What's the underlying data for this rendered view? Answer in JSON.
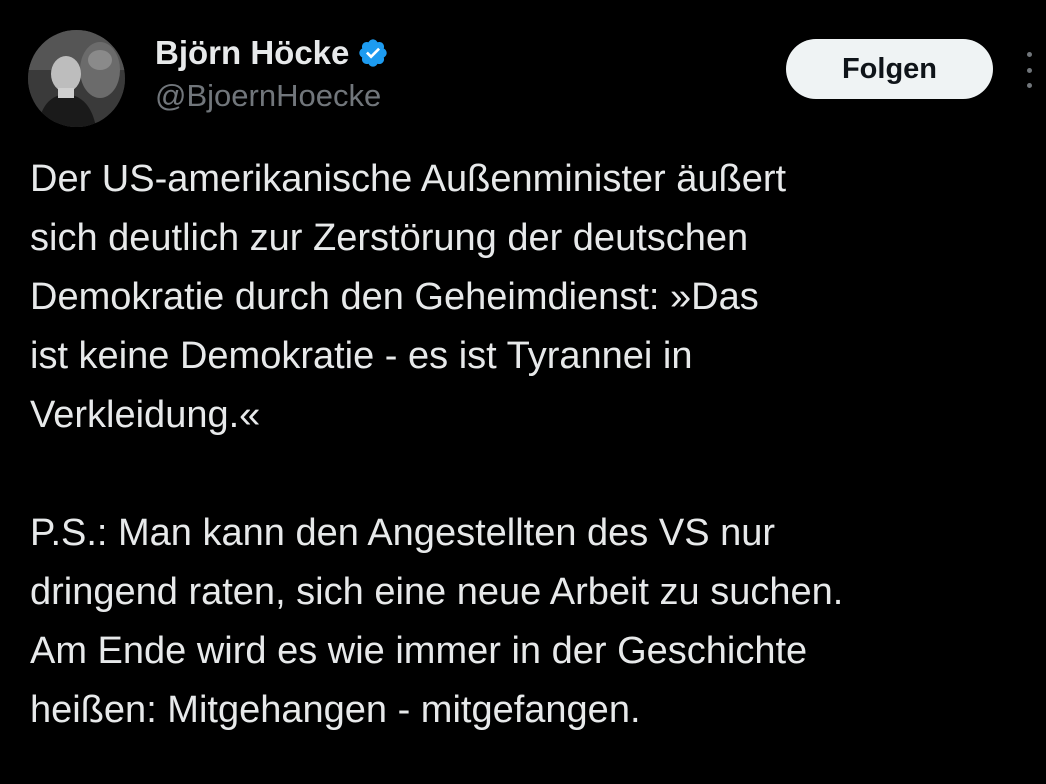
{
  "author": {
    "display_name": "Björn Höcke",
    "handle": "@BjoernHoecke",
    "verified": true,
    "avatar_icon": "profile-photo-icon"
  },
  "actions": {
    "follow_label": "Folgen",
    "more_icon": "more-options-icon"
  },
  "tweet": {
    "paragraphs": [
      {
        "lines": [
          "Der US-amerikanische Außenminister äußert",
          "sich deutlich zur Zerstörung der deutschen",
          "Demokratie durch den Geheimdienst:  »Das",
          "ist keine Demokratie - es ist Tyrannei in",
          "Verkleidung.«"
        ]
      },
      {
        "lines": [
          "P.S.: Man kann den Angestellten des VS nur",
          "dringend raten, sich eine neue Arbeit zu suchen.",
          "Am Ende wird es wie immer in der Geschichte",
          "heißen: Mitgehangen - mitgefangen."
        ]
      }
    ]
  },
  "colors": {
    "background": "#000000",
    "primary_text": "#e7e9ea",
    "secondary_text": "#71767b",
    "verified_badge": "#1d9bf0",
    "follow_button_bg": "#eff3f4",
    "follow_button_text": "#0f1419"
  }
}
